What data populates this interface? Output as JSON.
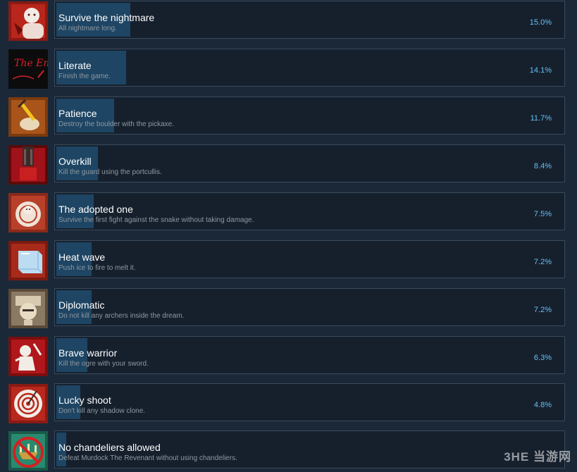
{
  "achievements": [
    {
      "title": "Survive the nightmare",
      "description": "All nightmare long.",
      "percent": "15.0%",
      "icon": "bald-man-icon",
      "progress": 15.0
    },
    {
      "title": "Literate",
      "description": "Finish the game.",
      "percent": "14.1%",
      "icon": "the-end-icon",
      "progress": 14.1
    },
    {
      "title": "Patience",
      "description": "Destroy the boulder with the pickaxe.",
      "percent": "11.7%",
      "icon": "pickaxe-icon",
      "progress": 11.7
    },
    {
      "title": "Overkill",
      "description": "Kill the guard using the portcullis.",
      "percent": "8.4%",
      "icon": "portcullis-icon",
      "progress": 8.4
    },
    {
      "title": "The adopted one",
      "description": "Survive the first fight against the snake without taking damage.",
      "percent": "7.5%",
      "icon": "coiled-snake-icon",
      "progress": 7.5
    },
    {
      "title": "Heat wave",
      "description": "Push ice to fire to melt it.",
      "percent": "7.2%",
      "icon": "ice-block-icon",
      "progress": 7.2
    },
    {
      "title": "Diplomatic",
      "description": "Do not kill any archers inside the dream.",
      "percent": "7.2%",
      "icon": "knight-helmet-icon",
      "progress": 7.2
    },
    {
      "title": "Brave warrior",
      "description": "Kill the ogre with your sword.",
      "percent": "6.3%",
      "icon": "warrior-icon",
      "progress": 6.3
    },
    {
      "title": "Lucky shoot",
      "description": "Don't kill any shadow clone.",
      "percent": "4.8%",
      "icon": "target-icon",
      "progress": 4.8
    },
    {
      "title": "No chandeliers allowed",
      "description": "Defeat Murdock The Revenant without using chandeliers.",
      "percent": "",
      "icon": "no-chandelier-icon",
      "progress": 2.0
    }
  ],
  "icon_text": {
    "the_end": "The End"
  },
  "watermark": "3HE 当游网",
  "colors": {
    "background": "#1b2838",
    "panel": "#16202d",
    "border": "#3a4b5c",
    "bar": "#1e4563",
    "title": "#ffffff",
    "description": "#8f98a0",
    "percent": "#66c0f4"
  }
}
